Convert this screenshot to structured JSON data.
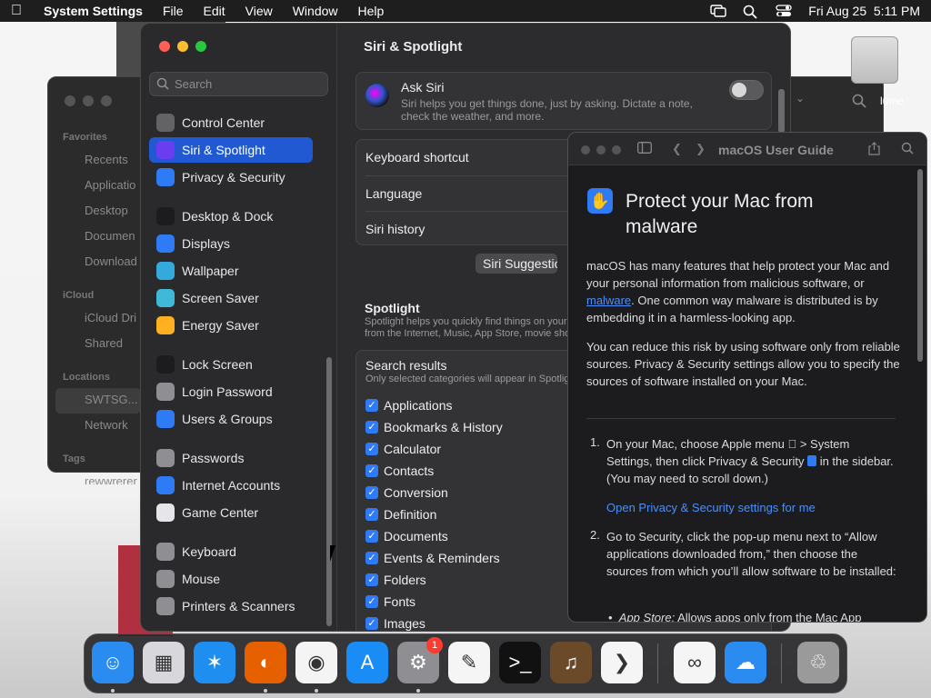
{
  "menubar": {
    "app_name": "System Settings",
    "menus": [
      "File",
      "Edit",
      "View",
      "Window",
      "Help"
    ],
    "clock": "Fri Aug 25  5:11 PM"
  },
  "finder": {
    "sections": [
      {
        "title": "Favorites",
        "items": [
          "Recents",
          "Applicatio",
          "Desktop",
          "Documen",
          "Download"
        ]
      },
      {
        "title": "iCloud",
        "items": [
          "iCloud Dri",
          "Shared"
        ]
      },
      {
        "title": "Locations",
        "items": [
          "SWTSG...",
          "Network"
        ]
      },
      {
        "title": "Tags",
        "items": [
          "rewwrerer"
        ]
      }
    ]
  },
  "desktop": {
    "disk_label": "lume"
  },
  "settings": {
    "search_placeholder": "Search",
    "sidebar": [
      {
        "label": "Control Center",
        "icon": "control-center-icon",
        "color": "#636366"
      },
      {
        "label": "Siri & Spotlight",
        "icon": "siri-icon",
        "color": "#6a3df0",
        "active": true
      },
      {
        "label": "Privacy & Security",
        "icon": "hand-icon",
        "color": "#2f7bf5"
      },
      {
        "label": "Desktop & Dock",
        "icon": "dock-icon",
        "color": "#1c1c1e"
      },
      {
        "label": "Displays",
        "icon": "sun-icon",
        "color": "#2f7bf5"
      },
      {
        "label": "Wallpaper",
        "icon": "flower-icon",
        "color": "#34aadc"
      },
      {
        "label": "Screen Saver",
        "icon": "screensaver-icon",
        "color": "#40b8d8"
      },
      {
        "label": "Energy Saver",
        "icon": "bulb-icon",
        "color": "#ffb020"
      },
      {
        "label": "Lock Screen",
        "icon": "lock-icon",
        "color": "#1c1c1e"
      },
      {
        "label": "Login Password",
        "icon": "lock-icon",
        "color": "#8e8e93"
      },
      {
        "label": "Users & Groups",
        "icon": "users-icon",
        "color": "#2f7bf5"
      },
      {
        "label": "Passwords",
        "icon": "key-icon",
        "color": "#8e8e93"
      },
      {
        "label": "Internet Accounts",
        "icon": "at-icon",
        "color": "#2f7bf5"
      },
      {
        "label": "Game Center",
        "icon": "game-center-icon",
        "color": "#e5e5ea"
      },
      {
        "label": "Keyboard",
        "icon": "keyboard-icon",
        "color": "#8e8e93"
      },
      {
        "label": "Mouse",
        "icon": "mouse-icon",
        "color": "#8e8e93"
      },
      {
        "label": "Printers & Scanners",
        "icon": "printer-icon",
        "color": "#8e8e93"
      }
    ],
    "title": "Siri & Spotlight",
    "ask_siri": {
      "title": "Ask Siri",
      "subtitle": "Siri helps you get things done, just by asking. Dictate a note, check the weather, and more.",
      "enabled": false
    },
    "rows": [
      "Keyboard shortcut",
      "Language",
      "Siri history"
    ],
    "suggestions_button": "Siri Suggestions",
    "spotlight": {
      "title": "Spotlight",
      "subtitle1": "Spotlight helps you quickly find things on your computer and shows suggestions",
      "subtitle2": "from the Internet, Music, App Store, movie showtimes, locations nearby, and more."
    },
    "search_results": {
      "title": "Search results",
      "subtitle": "Only selected categories will appear in Spotlight search results.",
      "items": [
        "Applications",
        "Bookmarks & History",
        "Calculator",
        "Contacts",
        "Conversion",
        "Definition",
        "Documents",
        "Events & Reminders",
        "Folders",
        "Fonts",
        "Images"
      ]
    }
  },
  "guide": {
    "window_title": "macOS User Guide",
    "heading": "Protect your Mac from malware",
    "p1_a": "macOS has many features that help protect your Mac and your personal information from malicious software, or ",
    "p1_link": "malware",
    "p1_b": ". One common way malware is distributed is by embedding it in a harmless-looking app.",
    "p2": "You can reduce this risk by using software only from reliable sources. Privacy & Security settings allow you to specify the sources of software installed on your Mac.",
    "step1_num": "1.",
    "step1_a": "On your Mac, choose Apple menu ",
    "step1_b": " > System Settings, then click Privacy & Security ",
    "step1_c": " in the sidebar. (You may need to scroll down.)",
    "open_link": "Open Privacy & Security settings for me",
    "step2_num": "2.",
    "step2": "Go to Security, click the pop-up menu next to “Allow applications downloaded from,” then choose the sources from which you’ll allow software to be installed:",
    "bullet_em": "App Store:",
    "bullet_rest": " Allows apps only from the Mac App"
  },
  "dock": {
    "apps": [
      {
        "name": "finder-app",
        "color": "#2a8cf0",
        "glyph": "☺",
        "running": true
      },
      {
        "name": "launchpad-app",
        "color": "#d8d8dc",
        "glyph": "▦"
      },
      {
        "name": "safari-app",
        "color": "#1f8ef1",
        "glyph": "✶"
      },
      {
        "name": "firefox-app",
        "color": "#e66000",
        "glyph": "◐",
        "running": true
      },
      {
        "name": "chrome-app",
        "color": "#f4f4f4",
        "glyph": "◉",
        "running": true
      },
      {
        "name": "app-store-app",
        "color": "#1a8cf5",
        "glyph": "A"
      },
      {
        "name": "system-settings-app",
        "color": "#8e8e93",
        "glyph": "⚙",
        "badge": "1",
        "running": true
      },
      {
        "name": "textedit-app",
        "color": "#f5f5f5",
        "glyph": "✎"
      },
      {
        "name": "terminal-app",
        "color": "#111111",
        "glyph": ">_"
      },
      {
        "name": "instruments-app",
        "color": "#6b4a2a",
        "glyph": "♫"
      },
      {
        "name": "vscode-app",
        "color": "#f5f5f5",
        "glyph": "❯"
      },
      {
        "name": "visual-studio-app",
        "color": "#f5f5f5",
        "glyph": "∞"
      },
      {
        "name": "weather-app",
        "color": "#2a8cf0",
        "glyph": "☁"
      },
      {
        "name": "trash-app",
        "color": "#9a9a9a",
        "glyph": "♲"
      }
    ]
  }
}
